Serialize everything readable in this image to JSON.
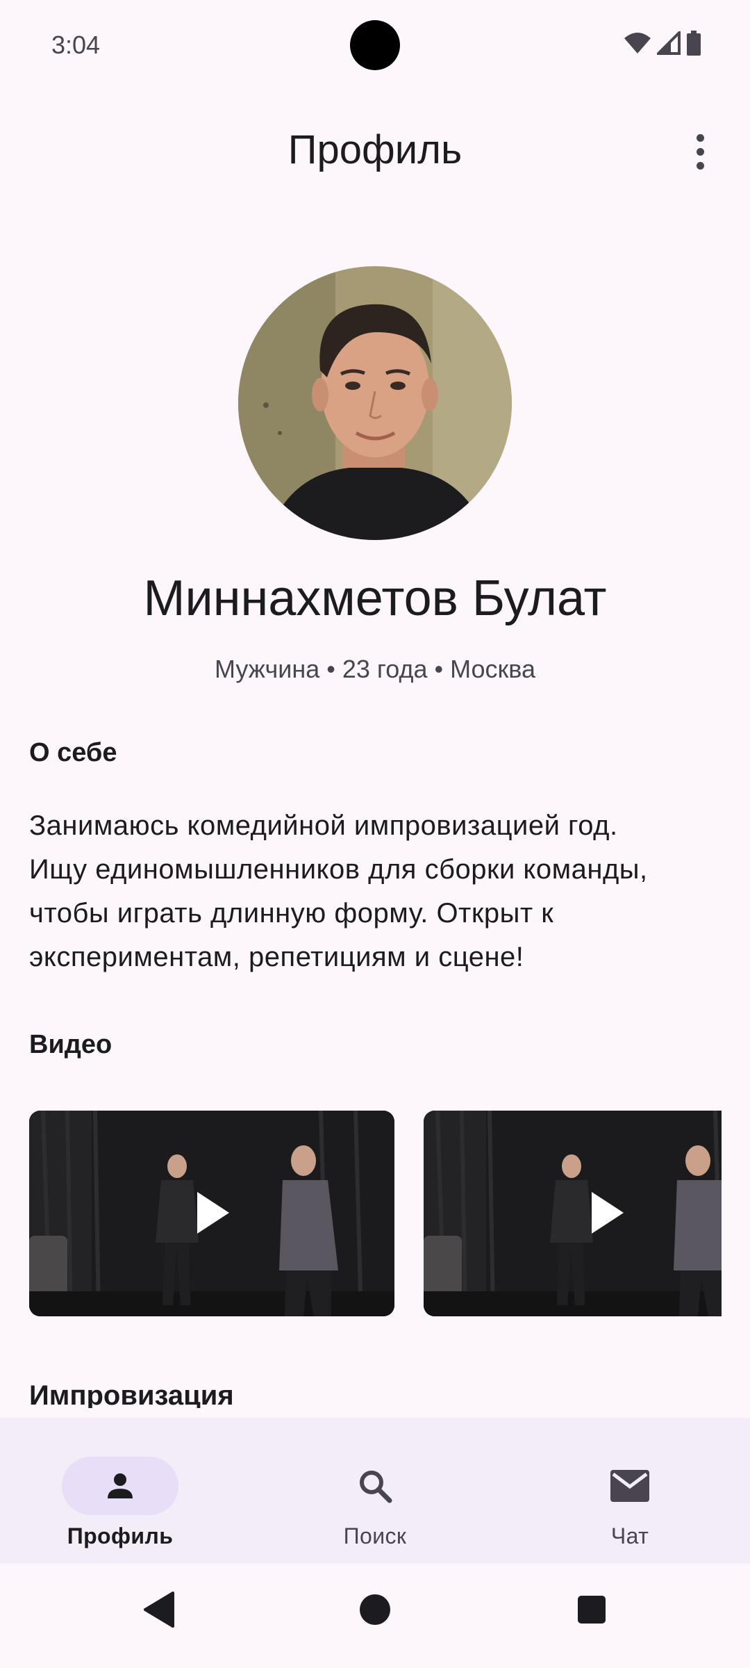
{
  "status_bar": {
    "time": "3:04",
    "icons": [
      "wifi-icon",
      "signal-icon",
      "battery-icon"
    ]
  },
  "top_bar": {
    "title": "Профиль",
    "more_icon": "more-vert-icon"
  },
  "profile": {
    "name": "Миннахметов Булат",
    "meta": "Мужчина • 23 года • Москва"
  },
  "about": {
    "title": "О себе",
    "lines": [
      "Занимаюсь комедийной импровизацией год.",
      "Ищу единомышленников для сборки команды,",
      "чтобы играть длинную форму. Открыт к",
      "экспериментам, репетициям и сцене!"
    ]
  },
  "videos": {
    "title": "Видео",
    "items": [
      {
        "icon": "play-icon"
      },
      {
        "icon": "play-icon"
      }
    ]
  },
  "next_section": {
    "title": "Импровизация"
  },
  "bottom_nav": {
    "items": [
      {
        "label": "Профиль",
        "icon": "person-icon",
        "active": true
      },
      {
        "label": "Поиск",
        "icon": "search-icon",
        "active": false
      },
      {
        "label": "Чат",
        "icon": "mail-icon",
        "active": false
      }
    ]
  },
  "colors": {
    "background": "#fdf7fc",
    "nav_background": "#f3edf7",
    "active_pill": "#e8def8",
    "text_primary": "#1c1b1f",
    "text_secondary": "#49454f"
  }
}
